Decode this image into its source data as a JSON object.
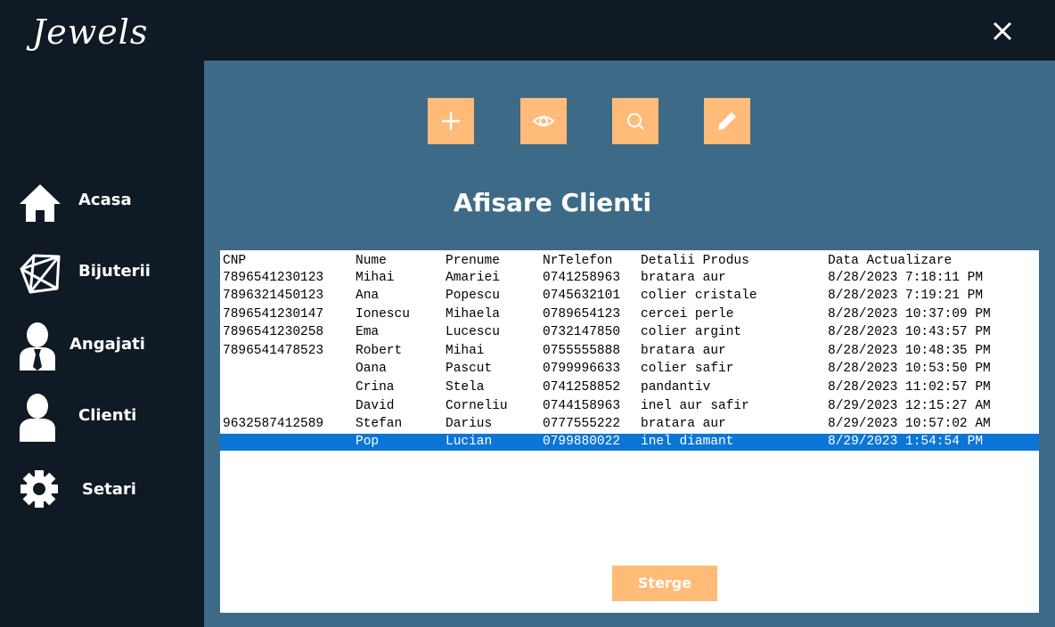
{
  "app": {
    "title": "Jewels"
  },
  "sidebar": {
    "items": [
      {
        "label": "Acasa",
        "icon": "home-icon"
      },
      {
        "label": "Bijuterii",
        "icon": "diamond-icon"
      },
      {
        "label": "Angajati",
        "icon": "employee-icon"
      },
      {
        "label": "Clienti",
        "icon": "user-icon"
      },
      {
        "label": "Setari",
        "icon": "gear-icon"
      }
    ]
  },
  "toolbar": {
    "buttons": [
      {
        "icon": "plus-icon"
      },
      {
        "icon": "eye-icon"
      },
      {
        "icon": "search-icon"
      },
      {
        "icon": "pencil-icon"
      }
    ]
  },
  "main": {
    "heading": "Afisare Clienti",
    "delete_label": "Sterge"
  },
  "list": {
    "header": {
      "cnp": "CNP",
      "nume": "Nume",
      "prenume": "Prenume",
      "tel": "NrTelefon",
      "prod": "Detalii Produs",
      "data": "Data Actualizare"
    },
    "rows": [
      {
        "cnp": "7896541230123",
        "nume": "Mihai",
        "prenume": "Amariei",
        "tel": "0741258963",
        "prod": "bratara aur",
        "data": "8/28/2023 7:18:11 PM"
      },
      {
        "cnp": "7896321450123",
        "nume": "Ana",
        "prenume": "Popescu",
        "tel": "0745632101",
        "prod": "colier cristale",
        "data": "8/28/2023 7:19:21 PM"
      },
      {
        "cnp": "7896541230147",
        "nume": "Ionescu",
        "prenume": "Mihaela",
        "tel": "0789654123",
        "prod": "cercei perle",
        "data": "8/28/2023 10:37:09 PM"
      },
      {
        "cnp": "7896541230258",
        "nume": "Ema",
        "prenume": "Lucescu",
        "tel": "0732147850",
        "prod": "colier argint",
        "data": "8/28/2023 10:43:57 PM"
      },
      {
        "cnp": "7896541478523",
        "nume": "Robert",
        "prenume": "Mihai",
        "tel": "0755555888",
        "prod": "bratara aur",
        "data": "8/28/2023 10:48:35 PM"
      },
      {
        "cnp": "",
        "nume": "Oana",
        "prenume": "Pascut",
        "tel": "0799996633",
        "prod": "colier safir",
        "data": "8/28/2023 10:53:50 PM"
      },
      {
        "cnp": "",
        "nume": "Crina",
        "prenume": "Stela",
        "tel": "0741258852",
        "prod": "pandantiv",
        "data": "8/28/2023 11:02:57 PM"
      },
      {
        "cnp": "",
        "nume": "David",
        "prenume": "Corneliu",
        "tel": "0744158963",
        "prod": "inel aur safir",
        "data": "8/29/2023 12:15:27 AM"
      },
      {
        "cnp": "9632587412589",
        "nume": "Stefan",
        "prenume": "Darius",
        "tel": "0777555222",
        "prod": "bratara aur",
        "data": "8/29/2023 10:57:02 AM"
      },
      {
        "cnp": "",
        "nume": "Pop",
        "prenume": "Lucian",
        "tel": "0799880022",
        "prod": "inel diamant",
        "data": "8/29/2023 1:54:54 PM"
      }
    ],
    "selected_index": 9
  },
  "colors": {
    "sidebar_bg": "#0f1a24",
    "main_bg": "#3d6b87",
    "accent": "#ffbb77",
    "selection": "#0b76d6"
  }
}
